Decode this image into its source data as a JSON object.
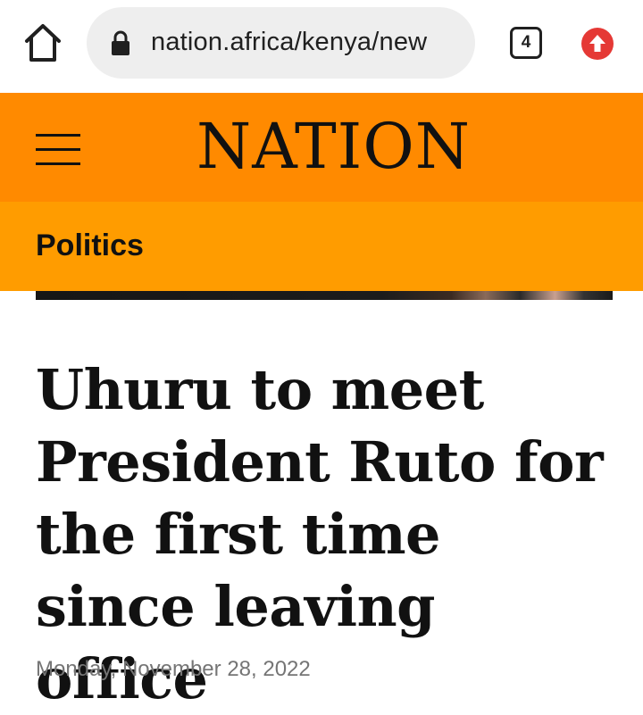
{
  "browser": {
    "url": "nation.africa/kenya/new",
    "tab_count": "4",
    "icons": [
      "home-icon",
      "lock-icon",
      "tabs-icon",
      "update-icon"
    ],
    "update_color": "#e53935"
  },
  "header": {
    "logo": "NATION",
    "background": "#ff8a00"
  },
  "section": {
    "label": "Politics",
    "background": "#ff9c00"
  },
  "article": {
    "headline": "Uhuru to meet President Ruto for the first time since leaving office",
    "date": "Monday, November 28, 2022"
  }
}
